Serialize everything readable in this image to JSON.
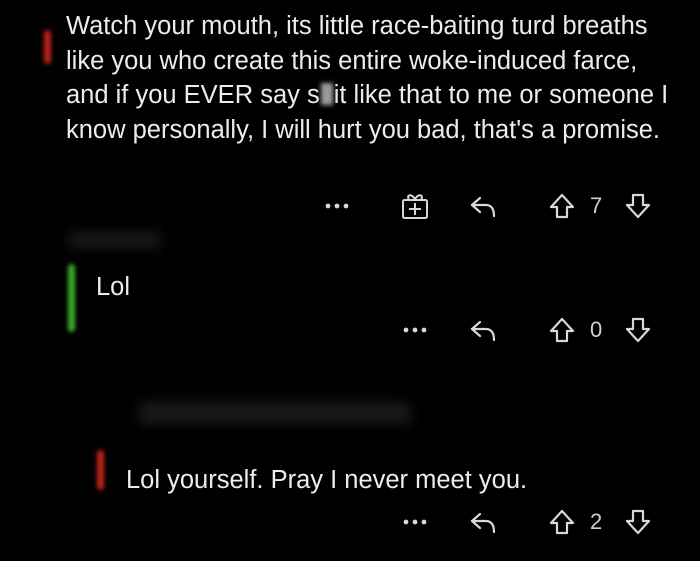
{
  "comments": [
    {
      "text_before_redaction": "Watch your mouth, its little race-baiting turd breaths like you who create this entire woke-induced farce, and if you EVER say s",
      "text_after_redaction": "it like that to me or someone I know personally, I will hurt you bad, that's a promise.",
      "score": "7",
      "thread_color": "#c0221b",
      "has_gift_icon": true
    },
    {
      "text": "Lol",
      "score": "0",
      "thread_color": "#3cae2a",
      "has_gift_icon": false
    },
    {
      "text": "Lol yourself. Pray I never meet you.",
      "score": "2",
      "thread_color": "#c0221b",
      "has_gift_icon": false
    }
  ],
  "icons": {
    "more": "more-dots-icon",
    "gift": "gift-award-icon",
    "reply": "reply-arrow-icon",
    "upvote": "upvote-arrow-icon",
    "downvote": "downvote-arrow-icon"
  }
}
